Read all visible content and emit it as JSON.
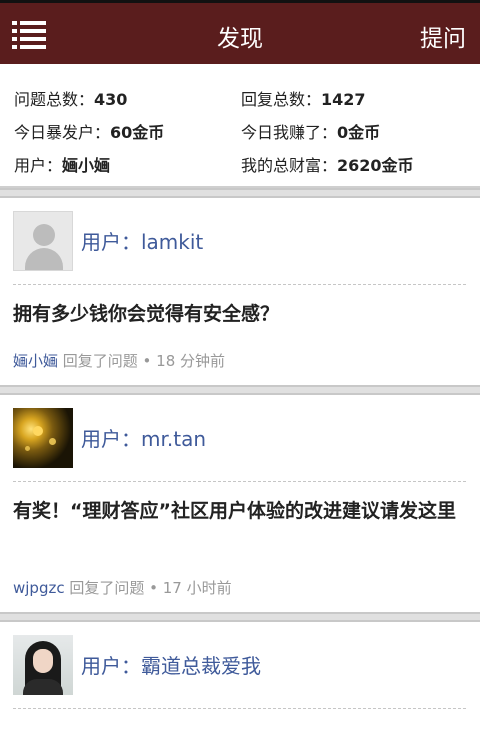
{
  "header": {
    "title": "发现",
    "ask_label": "提问",
    "menu_icon": "list-icon",
    "bg_color": "#5a1d1d"
  },
  "stats": {
    "question_total": {
      "label": "问题总数：",
      "value": "430"
    },
    "reply_total": {
      "label": "回复总数：",
      "value": "1427"
    },
    "today_payout": {
      "label": "今日暴发户：",
      "value": "60金币"
    },
    "today_earned": {
      "label": "今日我赚了：",
      "value": "0金币"
    },
    "user": {
      "label": "用户：",
      "value": "婳小婳"
    },
    "my_wealth": {
      "label": "我的总财富：",
      "value": "2620金币"
    }
  },
  "feed": [
    {
      "user_label": "用户：lamkit",
      "question": "拥有多少钱你会觉得有安全感？",
      "reply_user": "婳小婳",
      "reply_text": " 回复了问题 • 18 分钟前"
    },
    {
      "user_label": "用户：mr.tan",
      "question": "有奖！“理财答应”社区用户体验的改进建议请发这里",
      "reply_user": "wjpgzc",
      "reply_text": " 回复了问题 • 17 小时前"
    },
    {
      "user_label": "用户：霸道总裁爱我"
    }
  ],
  "colors": {
    "link": "#3f5a9a",
    "meta": "#999999"
  }
}
